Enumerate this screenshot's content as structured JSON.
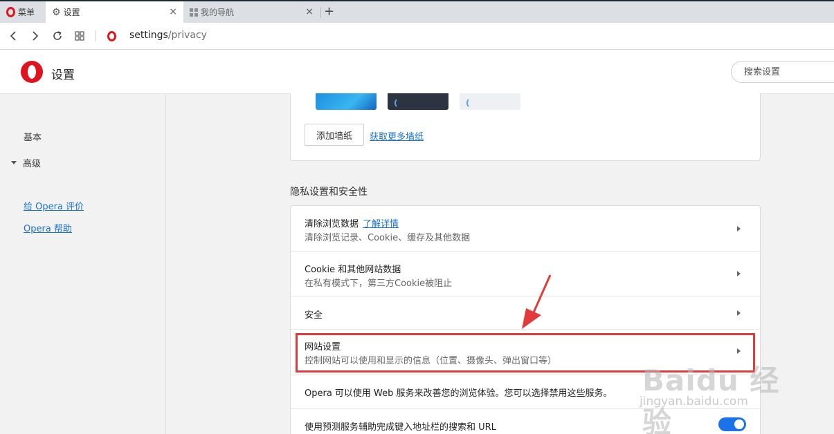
{
  "tabs": {
    "menu_label": "菜单",
    "settings_label": "设置",
    "nav_label": "我的导航",
    "close_glyph": "×",
    "new_tab_glyph": "+"
  },
  "addressbar": {
    "url_host": "settings",
    "url_path": "/privacy"
  },
  "header": {
    "title": "设置",
    "search_placeholder": "搜索设置"
  },
  "sidebar": {
    "basic": "基本",
    "advanced": "高级",
    "rate_link": "给 Opera 评价",
    "help_link": "Opera 帮助"
  },
  "wallpaper": {
    "add_button": "添加墙纸",
    "more_link": "获取更多墙纸"
  },
  "privacy": {
    "section_title": "隐私设置和安全性",
    "rows": [
      {
        "title": "清除浏览数据",
        "link": "了解详情",
        "subtitle": "清除浏览记录、Cookie、缓存及其他数据"
      },
      {
        "title": "Cookie 和其他网站数据",
        "subtitle": "在私有模式下，第三方Cookie被阻止"
      },
      {
        "title": "安全"
      },
      {
        "title": "网站设置",
        "subtitle": "控制网站可以使用和显示的信息（位置、摄像头、弹出窗口等）"
      },
      {
        "title": "Opera 可以使用 Web 服务来改善您的浏览体验。您可以选择禁用这些服务。"
      },
      {
        "title": "使用预测服务辅助完成键入地址栏的搜索和 URL",
        "toggle_on": true
      }
    ]
  },
  "colors": {
    "opera_red": "#e0141e",
    "link_blue": "#1a73c8",
    "highlight_red": "#e03c3c",
    "toggle_blue": "#1a73e8"
  },
  "watermark": {
    "main": "Baidu 经验",
    "sub": "jingyan.baidu.com"
  }
}
